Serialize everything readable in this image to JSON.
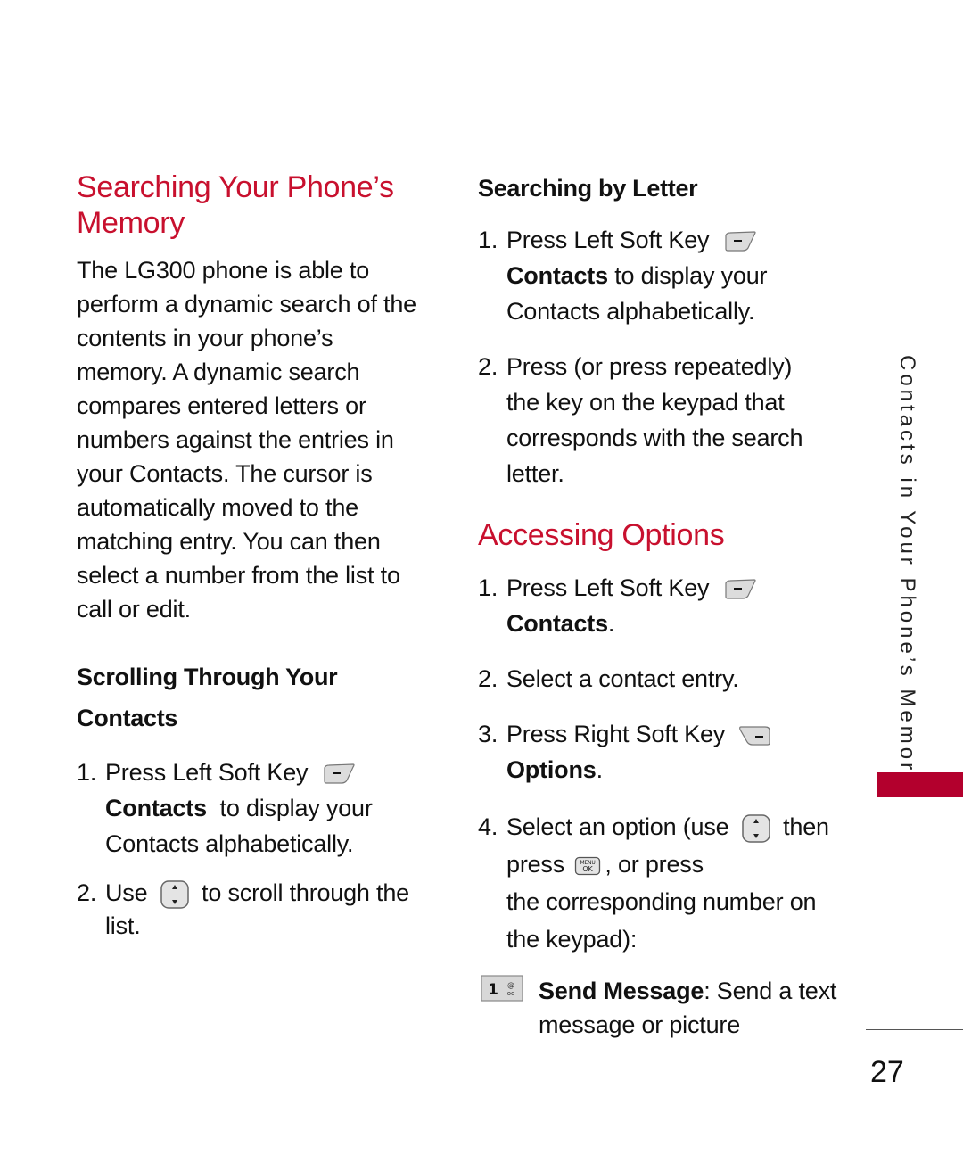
{
  "left": {
    "title_line1": "Searching Your Phone’s",
    "title_line2": "Memory",
    "intro": [
      "The LG300 phone is able to",
      "perform a dynamic search of the",
      "contents in your phone’s",
      "memory. A dynamic search",
      "compares entered letters or",
      "numbers against the entries in",
      "your Contacts.  The cursor is",
      "automatically moved to the",
      "matching entry. You can then",
      "select a number from the list to",
      "call or edit."
    ],
    "subhead_line1": "Scrolling Through Your",
    "subhead_line2": "Contacts",
    "steps": [
      {
        "num": "1.",
        "pre": "Press Left Soft Key",
        "icon": "left-soft-key-icon",
        "bold": "Contacts",
        "post": "  to display your",
        "line3": "Contacts alphabetically."
      },
      {
        "num": "2.",
        "pre": "Use",
        "icon": "nav-key-icon",
        "post": "to scroll through the",
        "line2": "list."
      }
    ]
  },
  "right": {
    "section1_heading": "Searching by Letter",
    "section1_steps": [
      {
        "num": "1.",
        "pre": "Press Left Soft Key",
        "icon": "left-soft-key-icon",
        "bold": "Contacts",
        "post": " to display your",
        "line3": "Contacts alphabetically."
      },
      {
        "num": "2.",
        "lines": [
          "Press (or press repeatedly)",
          "the key on the keypad that",
          "corresponds with the search",
          "letter."
        ]
      }
    ],
    "section2_title": "Accessing Options",
    "section2_steps": [
      {
        "num": "1.",
        "pre": "Press Left Soft Key",
        "icon": "left-soft-key-icon",
        "bold": "Contacts",
        "post": "."
      },
      {
        "num": "2.",
        "text": "Select a contact entry."
      },
      {
        "num": "3.",
        "pre": "Press Right Soft Key",
        "icon": "right-soft-key-icon",
        "bold": "Options",
        "post": "."
      },
      {
        "num": "4.",
        "pre": "Select an option (use",
        "icon": "nav-key-icon",
        "post": "then",
        "line2_pre": "press",
        "line2_icon": "menu-ok-key-icon",
        "line2_post": ", or press",
        "line3": "the corresponding number on",
        "line4": "the keypad):"
      }
    ],
    "option": {
      "key_label": "1",
      "bold": "Send Message",
      "text": ": Send a text",
      "line2": "message or picture"
    }
  },
  "sidebar": {
    "chapter_label": "Contacts in Your Phone’s Memory",
    "accent_color": "#b3002d"
  },
  "page_number": "27",
  "colors": {
    "title_red": "#c8102e"
  }
}
